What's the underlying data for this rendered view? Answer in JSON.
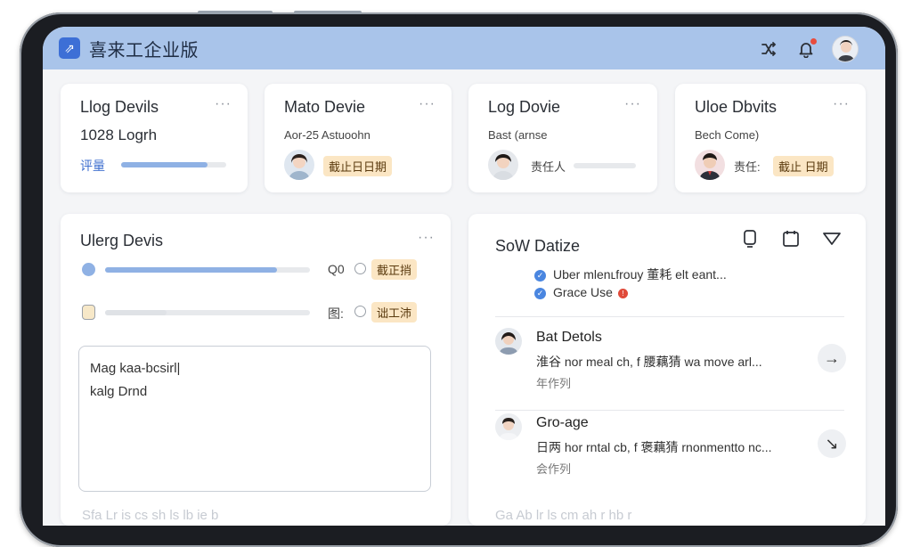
{
  "header": {
    "title": "喜来工企业版",
    "logo_glyph": "⇗",
    "icons": [
      "shuffle-icon",
      "bell-icon",
      "user-avatar"
    ],
    "accent": "#a9c4ea",
    "notification_color": "#e84c3d"
  },
  "top_cards": [
    {
      "title": "Llog Devils",
      "more": "···",
      "subtitle": "1028 Logrh",
      "progress_label": "评量",
      "progress": 0.82
    },
    {
      "title": "Mato Devie",
      "more": "···",
      "subtitle": "Aor-25 Astuoohn",
      "tag": "截止日日期"
    },
    {
      "title": "Log Dovie",
      "more": "···",
      "subtitle": "Bast (arnse",
      "assignee_label": "责任人"
    },
    {
      "title": "Uloe Dbvits",
      "more": "···",
      "subtitle": "Bech Come)",
      "assignee_label": "责任:",
      "tag": "截止 日期"
    }
  ],
  "left_panel": {
    "title": "Ulerg Devis",
    "more": "···",
    "rows": [
      {
        "progress": 0.84,
        "value_label": "Q0",
        "tag": "截正捎"
      },
      {
        "progress": 0.3,
        "value_label": "图:",
        "tag": "诎工沛"
      }
    ],
    "textarea_value": "Mag kaa-bcsirl|\nkalg Drnd",
    "bottom_fade": "Sfa   Lr   is   cs   sh   ls   lb   ie   b"
  },
  "right_panel": {
    "title": "SoW Datize",
    "toolbar_icons": [
      "phone-icon",
      "calendar-icon",
      "filter-icon"
    ],
    "checks": [
      {
        "text": "Uber mlenʟfrouy 董耗 elt eant...",
        "status": "ok"
      },
      {
        "text": "Grace Use",
        "status": "error"
      }
    ],
    "items": [
      {
        "name": "Bat Detols",
        "snippet": "淮谷 nor meal ch, f 腰藕猜 wa move arl...",
        "meta": "年作列",
        "action": "→"
      },
      {
        "name": "Gro-age",
        "snippet": "日两 hor rntal cb, f 褒藕猜 rnonmentto nc...",
        "meta": "会作列",
        "action": "↘"
      }
    ],
    "bottom_fade": "Ga  Ab  lr  ls  cm  ah  r  hb  r"
  }
}
